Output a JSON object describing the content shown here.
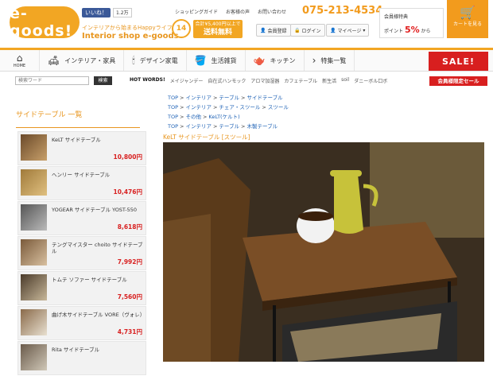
{
  "header": {
    "logo_text": "e-goods!",
    "fb_like": "いいね！",
    "fb_count": "1.2万",
    "tagline": "インテリアから始まるHappyライフ",
    "shop_name": "Interior shop e-goods",
    "anniversary": "14",
    "free_shipping": "合計¥5,400円以上で",
    "free_shipping2": "送料無料",
    "links": [
      "ショッピングガイド",
      "お客様の声",
      "お問い合わせ"
    ],
    "phone": "075-213-4534",
    "register": "会員登録",
    "login": "ログイン",
    "mypage": "マイページ",
    "member_label": "会員様特典",
    "points_label": "ポイント",
    "points_pct": "5%",
    "points_suffix": "から",
    "cart": "カートを見る"
  },
  "nav": {
    "home": "HOME",
    "items": [
      "インテリア・家具",
      "デザイン家電",
      "生活雑貨",
      "キッチン",
      "特集一覧"
    ],
    "sale": "SALE!"
  },
  "search": {
    "placeholder": "検索ワード",
    "button": "検索",
    "hot_label": "HOT WORDS!",
    "hot_words": [
      "メイジャンデー",
      "自在式ハンモック",
      "アロマ加湿器",
      "カフェテーブル",
      "新生活",
      "soil",
      "ダニーボル口ボ"
    ],
    "member_sale": "会員様限定セール"
  },
  "sidebar": {
    "title": "サイドテーブル 一覧",
    "products": [
      {
        "name": "KeLT サイドテーブル",
        "price": "10,800円"
      },
      {
        "name": "ヘンリー サイドテーブル",
        "price": "10,476円"
      },
      {
        "name": "YOGEAR サイドテーブル YOST-550",
        "price": "8,618円"
      },
      {
        "name": "テングマイスター choito サイドテーブル",
        "price": "7,992円"
      },
      {
        "name": "トムテ ソファー サイドテーブル",
        "price": "7,560円"
      },
      {
        "name": "曲げ木サイドテーブル VORE（ヴォレ）",
        "price": "4,731円"
      },
      {
        "name": "Rita サイドテーブル",
        "price": ""
      }
    ]
  },
  "breadcrumbs": [
    [
      "TOP",
      "インテリア",
      "テーブル",
      "サイドテーブル"
    ],
    [
      "TOP",
      "インテリア",
      "チェア・スツール",
      "スツール"
    ],
    [
      "TOP",
      "その他",
      "KeLT(ケルト)"
    ],
    [
      "TOP",
      "インテリア",
      "テーブル",
      "木製テーブル"
    ]
  ],
  "product_title": "KeLT サイドテーブル [スツール]",
  "colors": {
    "accent": "#f2a623",
    "sale": "#d81f1f",
    "link": "#1a5fb4"
  }
}
